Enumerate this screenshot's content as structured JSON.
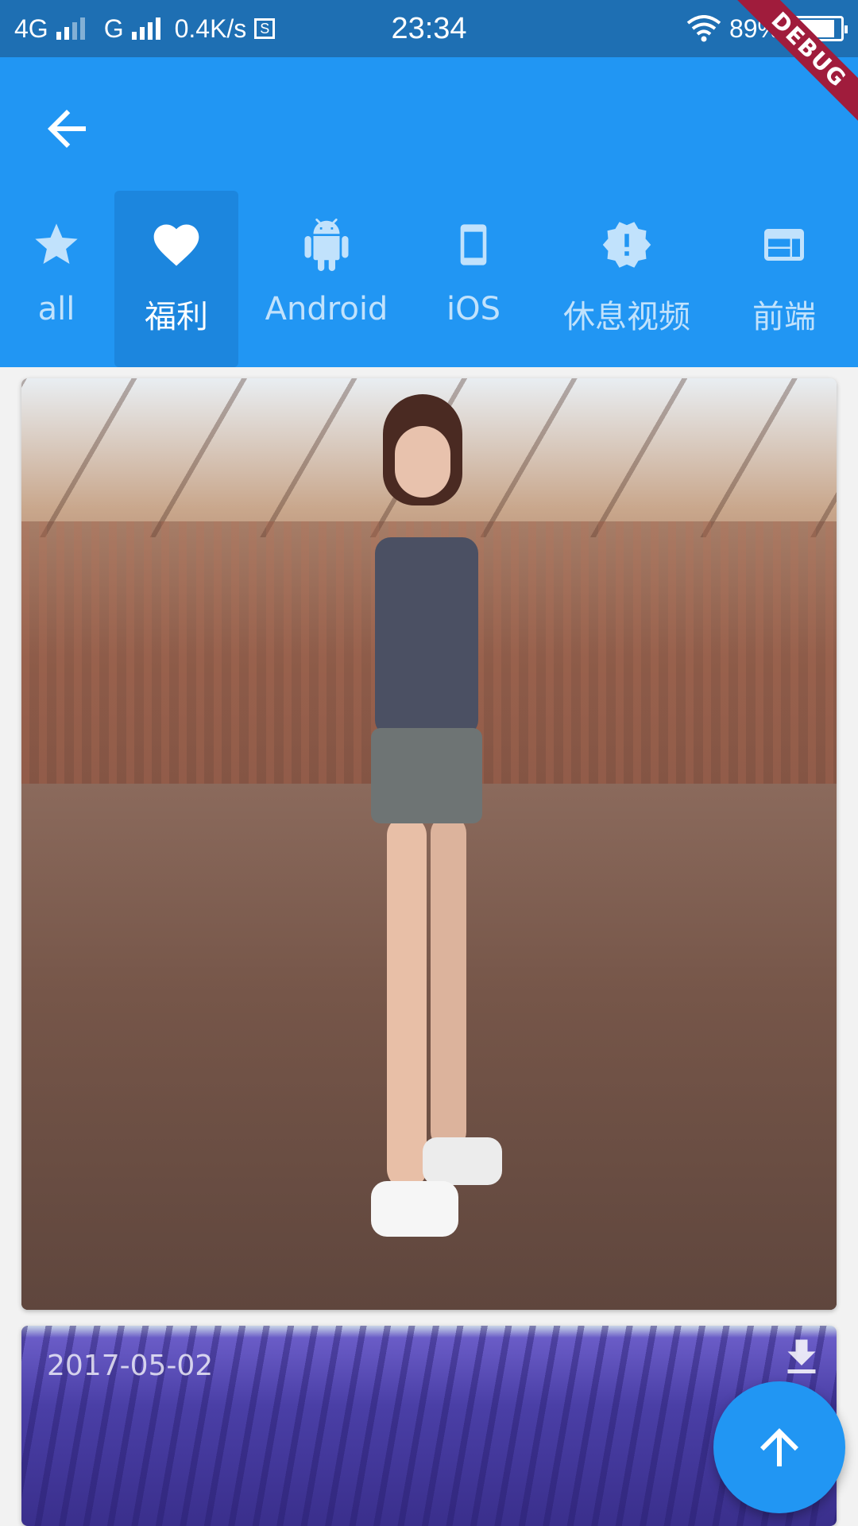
{
  "status_bar": {
    "network1": "4G",
    "network2": "G",
    "speed": "0.4K/s",
    "sim_badge": "S",
    "time": "23:34",
    "battery": "89%"
  },
  "debug_banner": "DEBUG",
  "tabs": [
    {
      "label": "all",
      "icon": "star-icon"
    },
    {
      "label": "福利",
      "icon": "heart-icon"
    },
    {
      "label": "Android",
      "icon": "android-icon"
    },
    {
      "label": "iOS",
      "icon": "phone-icon"
    },
    {
      "label": "休息视频",
      "icon": "alert-badge-icon"
    },
    {
      "label": "前端",
      "icon": "web-icon"
    }
  ],
  "active_tab": "福利",
  "feed": {
    "cards": [
      {
        "date": ""
      },
      {
        "date": "2017-05-02"
      }
    ]
  },
  "colors": {
    "appbar": "#2196f3",
    "statusbar": "#1e6fb3",
    "active_tab_bg": "#1c86de",
    "debug": "#a01c3c"
  }
}
